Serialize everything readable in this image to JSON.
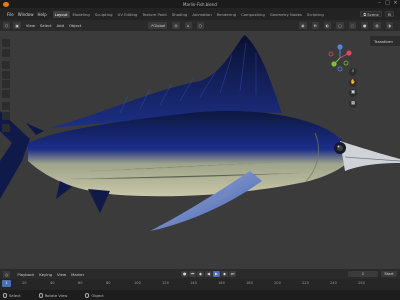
{
  "window": {
    "title": "Marlin-Fish.blend"
  },
  "menu": [
    "File",
    "Window",
    "Help"
  ],
  "workspace_tabs": [
    {
      "label": "Layout",
      "active": true
    },
    {
      "label": "Modeling",
      "active": false
    },
    {
      "label": "Sculpting",
      "active": false
    },
    {
      "label": "UV Editing",
      "active": false
    },
    {
      "label": "Texture Paint",
      "active": false
    },
    {
      "label": "Shading",
      "active": false
    },
    {
      "label": "Animation",
      "active": false
    },
    {
      "label": "Rendering",
      "active": false
    },
    {
      "label": "Compositing",
      "active": false
    },
    {
      "label": "Geometry Nodes",
      "active": false
    },
    {
      "label": "Scripting",
      "active": false
    }
  ],
  "scene": {
    "name": "Scene"
  },
  "viewport_header": {
    "mode": "Object Mode",
    "menus": [
      "View",
      "Select",
      "Add",
      "Object"
    ],
    "orientation": "Global"
  },
  "sidebar": {
    "transforms_label": "Transform"
  },
  "gizmo": {
    "x_color": "#e0475c",
    "y_color": "#7fbf3c",
    "z_color": "#4d86e0"
  },
  "timeline": {
    "menus": [
      "Playback",
      "Keying",
      "View",
      "Marker"
    ],
    "current_frame": "1",
    "start_label": "Start"
  },
  "ruler": {
    "current": "1",
    "ticks": [
      "1",
      "20",
      "40",
      "60",
      "80",
      "100",
      "120",
      "140",
      "160",
      "180",
      "200",
      "220",
      "240",
      "250"
    ]
  },
  "status": [
    {
      "label": "Select"
    },
    {
      "label": "Rotate View"
    },
    {
      "label": "Object"
    }
  ]
}
